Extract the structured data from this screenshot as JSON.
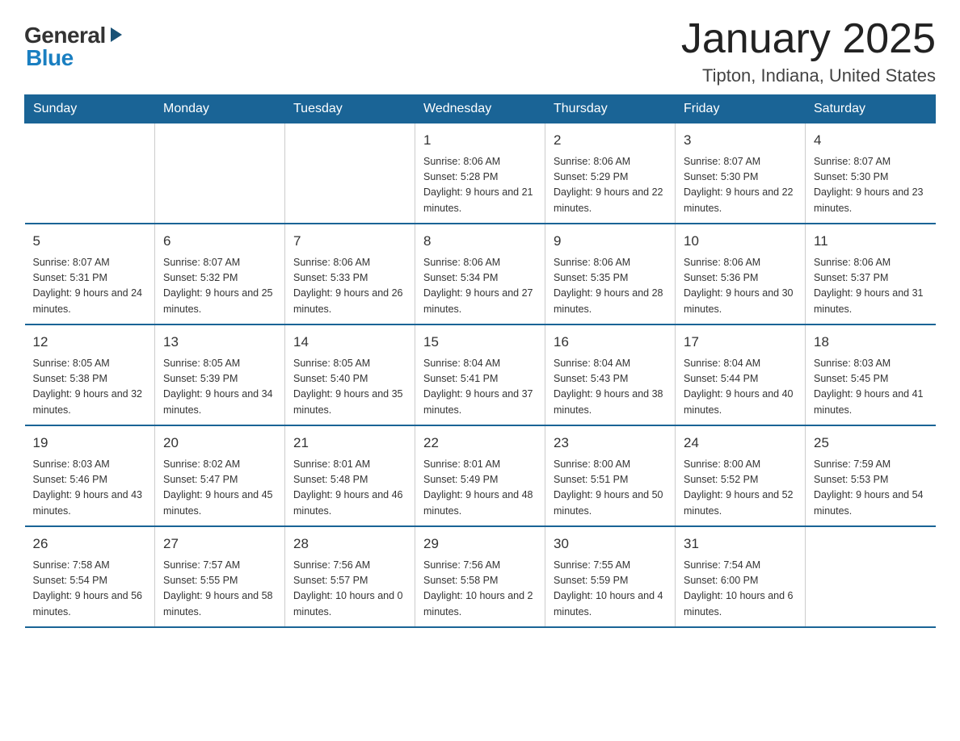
{
  "header": {
    "logo_general": "General",
    "logo_blue": "Blue",
    "month_year": "January 2025",
    "location": "Tipton, Indiana, United States"
  },
  "days_of_week": [
    "Sunday",
    "Monday",
    "Tuesday",
    "Wednesday",
    "Thursday",
    "Friday",
    "Saturday"
  ],
  "weeks": [
    {
      "days": [
        {
          "num": "",
          "info": ""
        },
        {
          "num": "",
          "info": ""
        },
        {
          "num": "",
          "info": ""
        },
        {
          "num": "1",
          "info": "Sunrise: 8:06 AM\nSunset: 5:28 PM\nDaylight: 9 hours and 21 minutes."
        },
        {
          "num": "2",
          "info": "Sunrise: 8:06 AM\nSunset: 5:29 PM\nDaylight: 9 hours and 22 minutes."
        },
        {
          "num": "3",
          "info": "Sunrise: 8:07 AM\nSunset: 5:30 PM\nDaylight: 9 hours and 22 minutes."
        },
        {
          "num": "4",
          "info": "Sunrise: 8:07 AM\nSunset: 5:30 PM\nDaylight: 9 hours and 23 minutes."
        }
      ]
    },
    {
      "days": [
        {
          "num": "5",
          "info": "Sunrise: 8:07 AM\nSunset: 5:31 PM\nDaylight: 9 hours and 24 minutes."
        },
        {
          "num": "6",
          "info": "Sunrise: 8:07 AM\nSunset: 5:32 PM\nDaylight: 9 hours and 25 minutes."
        },
        {
          "num": "7",
          "info": "Sunrise: 8:06 AM\nSunset: 5:33 PM\nDaylight: 9 hours and 26 minutes."
        },
        {
          "num": "8",
          "info": "Sunrise: 8:06 AM\nSunset: 5:34 PM\nDaylight: 9 hours and 27 minutes."
        },
        {
          "num": "9",
          "info": "Sunrise: 8:06 AM\nSunset: 5:35 PM\nDaylight: 9 hours and 28 minutes."
        },
        {
          "num": "10",
          "info": "Sunrise: 8:06 AM\nSunset: 5:36 PM\nDaylight: 9 hours and 30 minutes."
        },
        {
          "num": "11",
          "info": "Sunrise: 8:06 AM\nSunset: 5:37 PM\nDaylight: 9 hours and 31 minutes."
        }
      ]
    },
    {
      "days": [
        {
          "num": "12",
          "info": "Sunrise: 8:05 AM\nSunset: 5:38 PM\nDaylight: 9 hours and 32 minutes."
        },
        {
          "num": "13",
          "info": "Sunrise: 8:05 AM\nSunset: 5:39 PM\nDaylight: 9 hours and 34 minutes."
        },
        {
          "num": "14",
          "info": "Sunrise: 8:05 AM\nSunset: 5:40 PM\nDaylight: 9 hours and 35 minutes."
        },
        {
          "num": "15",
          "info": "Sunrise: 8:04 AM\nSunset: 5:41 PM\nDaylight: 9 hours and 37 minutes."
        },
        {
          "num": "16",
          "info": "Sunrise: 8:04 AM\nSunset: 5:43 PM\nDaylight: 9 hours and 38 minutes."
        },
        {
          "num": "17",
          "info": "Sunrise: 8:04 AM\nSunset: 5:44 PM\nDaylight: 9 hours and 40 minutes."
        },
        {
          "num": "18",
          "info": "Sunrise: 8:03 AM\nSunset: 5:45 PM\nDaylight: 9 hours and 41 minutes."
        }
      ]
    },
    {
      "days": [
        {
          "num": "19",
          "info": "Sunrise: 8:03 AM\nSunset: 5:46 PM\nDaylight: 9 hours and 43 minutes."
        },
        {
          "num": "20",
          "info": "Sunrise: 8:02 AM\nSunset: 5:47 PM\nDaylight: 9 hours and 45 minutes."
        },
        {
          "num": "21",
          "info": "Sunrise: 8:01 AM\nSunset: 5:48 PM\nDaylight: 9 hours and 46 minutes."
        },
        {
          "num": "22",
          "info": "Sunrise: 8:01 AM\nSunset: 5:49 PM\nDaylight: 9 hours and 48 minutes."
        },
        {
          "num": "23",
          "info": "Sunrise: 8:00 AM\nSunset: 5:51 PM\nDaylight: 9 hours and 50 minutes."
        },
        {
          "num": "24",
          "info": "Sunrise: 8:00 AM\nSunset: 5:52 PM\nDaylight: 9 hours and 52 minutes."
        },
        {
          "num": "25",
          "info": "Sunrise: 7:59 AM\nSunset: 5:53 PM\nDaylight: 9 hours and 54 minutes."
        }
      ]
    },
    {
      "days": [
        {
          "num": "26",
          "info": "Sunrise: 7:58 AM\nSunset: 5:54 PM\nDaylight: 9 hours and 56 minutes."
        },
        {
          "num": "27",
          "info": "Sunrise: 7:57 AM\nSunset: 5:55 PM\nDaylight: 9 hours and 58 minutes."
        },
        {
          "num": "28",
          "info": "Sunrise: 7:56 AM\nSunset: 5:57 PM\nDaylight: 10 hours and 0 minutes."
        },
        {
          "num": "29",
          "info": "Sunrise: 7:56 AM\nSunset: 5:58 PM\nDaylight: 10 hours and 2 minutes."
        },
        {
          "num": "30",
          "info": "Sunrise: 7:55 AM\nSunset: 5:59 PM\nDaylight: 10 hours and 4 minutes."
        },
        {
          "num": "31",
          "info": "Sunrise: 7:54 AM\nSunset: 6:00 PM\nDaylight: 10 hours and 6 minutes."
        },
        {
          "num": "",
          "info": ""
        }
      ]
    }
  ]
}
